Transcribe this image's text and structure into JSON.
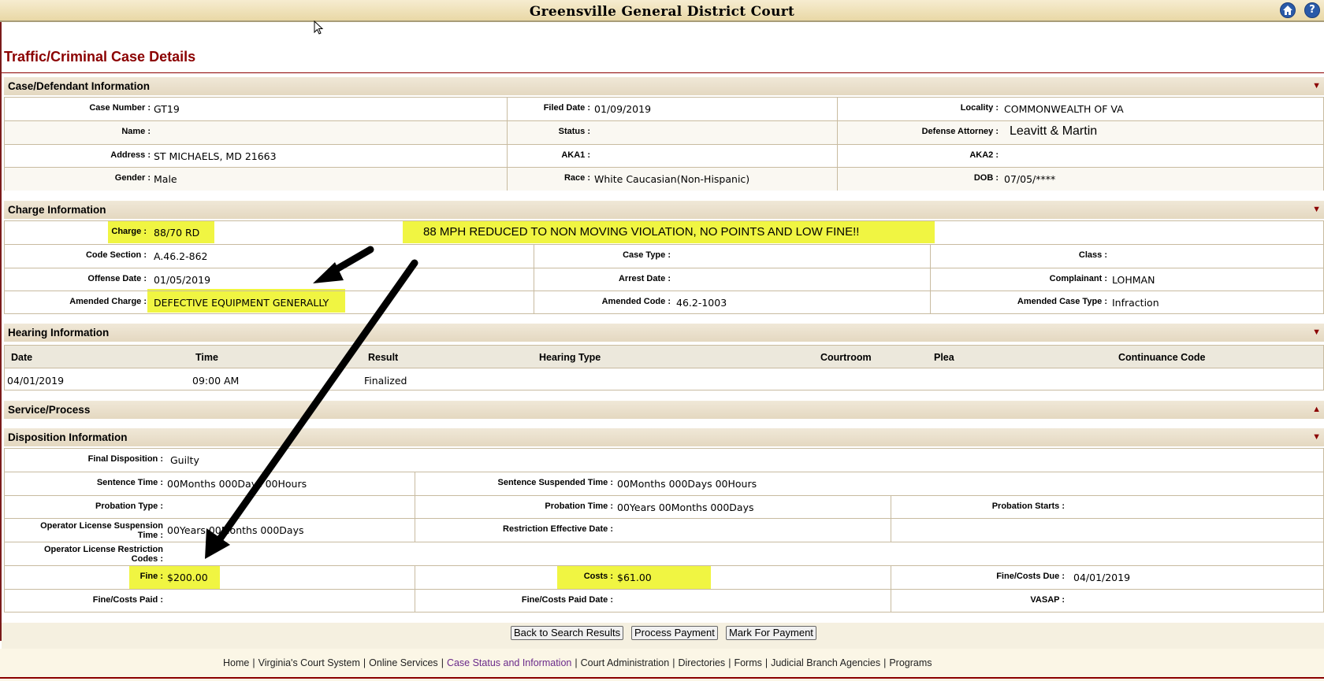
{
  "header": {
    "title": "Greensville General District Court"
  },
  "page_title": "Traffic/Criminal Case Details",
  "sections": {
    "case": "Case/Defendant Information",
    "charge": "Charge Information",
    "hearing": "Hearing Information",
    "service": "Service/Process",
    "disposition": "Disposition Information",
    "collapse_glyph": "▼",
    "expand_glyph": "▲"
  },
  "case": {
    "case_number_label": "Case Number :",
    "case_number": "GT19",
    "filed_date_label": "Filed Date :",
    "filed_date": "01/09/2019",
    "locality_label": "Locality :",
    "locality": "COMMONWEALTH OF VA",
    "name_label": "Name :",
    "name": "",
    "status_label": "Status :",
    "status": "",
    "defense_attorney_label": "Defense Attorney :",
    "defense_attorney": "Leavitt & Martin",
    "address_label": "Address :",
    "address": "ST MICHAELS, MD 21663",
    "aka1_label": "AKA1 :",
    "aka1": "",
    "aka2_label": "AKA2 :",
    "aka2": "",
    "gender_label": "Gender :",
    "gender": "Male",
    "race_label": "Race :",
    "race": "White Caucasian(Non-Hispanic)",
    "dob_label": "DOB :",
    "dob": "07/05/****"
  },
  "charge": {
    "charge_label": "Charge :",
    "charge": "88/70 RD",
    "annotation": "88 MPH REDUCED TO NON MOVING VIOLATION, NO POINTS AND LOW FINE!!",
    "code_section_label": "Code Section :",
    "code_section": "A.46.2-862",
    "case_type_label": "Case Type :",
    "case_type": "",
    "class_label": "Class :",
    "class": "",
    "offense_date_label": "Offense Date :",
    "offense_date": "01/05/2019",
    "arrest_date_label": "Arrest Date :",
    "arrest_date": "",
    "complainant_label": "Complainant :",
    "complainant": "LOHMAN",
    "amended_charge_label": "Amended Charge :",
    "amended_charge": "DEFECTIVE EQUIPMENT GENERALLY",
    "amended_code_label": "Amended Code :",
    "amended_code": "46.2-1003",
    "amended_case_type_label": "Amended Case Type :",
    "amended_case_type": "Infraction"
  },
  "hearing": {
    "columns": [
      "Date",
      "Time",
      "Result",
      "Hearing Type",
      "Courtroom",
      "Plea",
      "Continuance Code"
    ],
    "row": [
      "04/01/2019",
      "09:00 AM",
      "Finalized",
      "",
      "",
      "",
      ""
    ]
  },
  "disposition": {
    "final_disposition_label": "Final Disposition :",
    "final_disposition": "Guilty",
    "sentence_time_label": "Sentence Time :",
    "sentence_time": "00Months 000Days 00Hours",
    "sentence_suspended_label": "Sentence Suspended Time :",
    "sentence_suspended": "00Months 000Days 00Hours",
    "probation_type_label": "Probation Type :",
    "probation_type": "",
    "probation_time_label": "Probation Time :",
    "probation_time": "00Years 00Months 000Days",
    "probation_starts_label": "Probation Starts :",
    "probation_starts": "",
    "ol_suspension_label_1": "Operator License Suspension",
    "ol_suspension_label_2": "Time :",
    "ol_suspension": "00Years 00Months 000Days",
    "restriction_effective_label": "Restriction Effective Date :",
    "restriction_effective": "",
    "ol_restriction_label_1": "Operator License Restriction",
    "ol_restriction_label_2": "Codes :",
    "fine_label": "Fine :",
    "fine": "$200.00",
    "costs_label": "Costs :",
    "costs": "$61.00",
    "due_label": "Fine/Costs Due :",
    "due": "04/01/2019",
    "paid_label": "Fine/Costs Paid :",
    "paid": "",
    "paid_date_label": "Fine/Costs Paid Date :",
    "paid_date": "",
    "vasap_label": "VASAP :",
    "vasap": ""
  },
  "buttons": {
    "back": "Back to Search Results",
    "process": "Process Payment",
    "mark": "Mark For Payment"
  },
  "footer": {
    "links": [
      "Home",
      "Virginia's Court System",
      "Online Services",
      "Case Status and Information",
      "Court Administration",
      "Directories",
      "Forms",
      "Judicial Branch Agencies",
      "Programs"
    ],
    "separator": "|"
  },
  "colors": {
    "highlight": "#f0f542",
    "accent": "#8b0000",
    "header_bg": "#e9d8a6"
  },
  "icons": {
    "home": "home-icon",
    "help": "help-icon",
    "cursor": "mouse-cursor-icon",
    "arrows": "annotation-arrow-icon"
  }
}
